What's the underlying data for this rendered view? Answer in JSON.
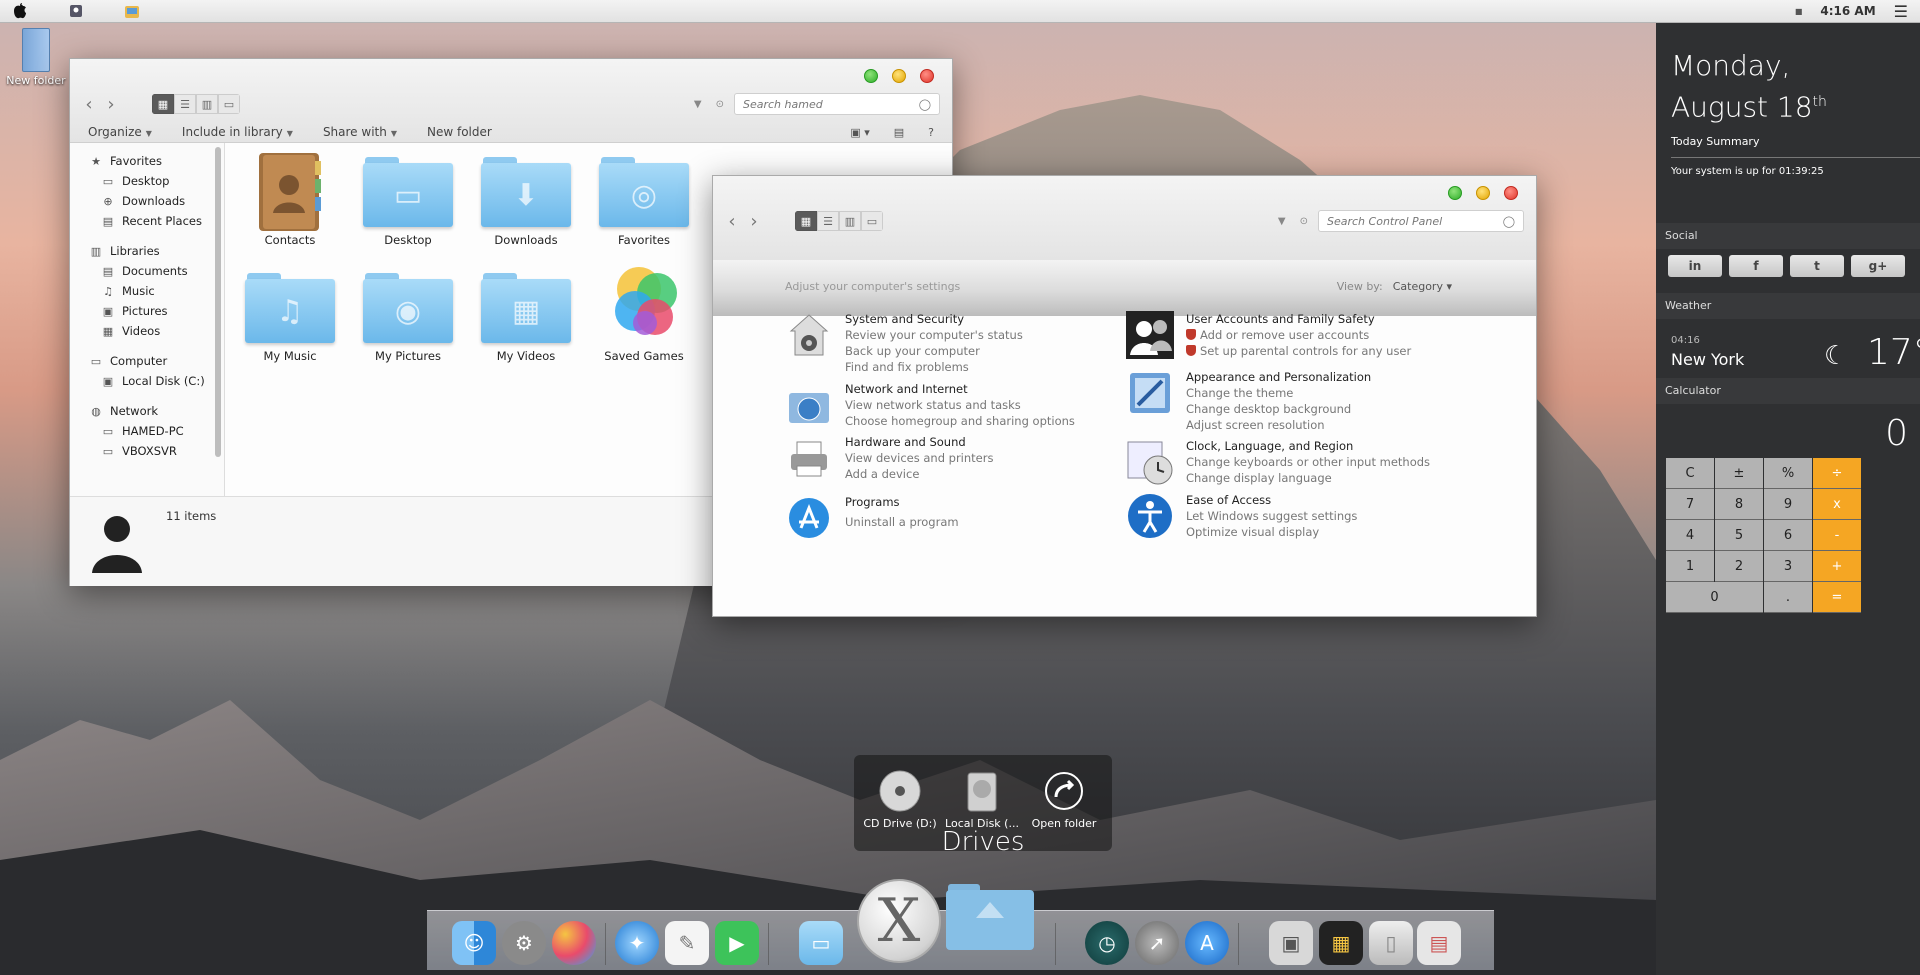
{
  "menubar": {
    "time": "4:16 AM"
  },
  "desktop": {
    "folder_label": "New folder"
  },
  "explorer": {
    "search_placeholder": "Search hamed",
    "commands": [
      "Organize",
      "Include in library",
      "Share with",
      "New folder"
    ],
    "nav": {
      "favorites": {
        "label": "Favorites",
        "items": [
          "Desktop",
          "Downloads",
          "Recent Places"
        ]
      },
      "libraries": {
        "label": "Libraries",
        "items": [
          "Documents",
          "Music",
          "Pictures",
          "Videos"
        ]
      },
      "computer": {
        "label": "Computer",
        "items": [
          "Local Disk (C:)"
        ]
      },
      "network": {
        "label": "Network",
        "items": [
          "HAMED-PC",
          "VBOXSVR"
        ]
      }
    },
    "files": [
      "Contacts",
      "Desktop",
      "Downloads",
      "Favorites",
      "My Music",
      "My Pictures",
      "My Videos",
      "Saved Games"
    ],
    "item_count": "11 items"
  },
  "control_panel": {
    "search_placeholder": "Search Control Panel",
    "heading": "Adjust your computer's settings",
    "view_by_label": "View by:",
    "view_by_value": "Category",
    "categories": [
      {
        "title": "System and Security",
        "links": [
          "Review your computer's status",
          "Back up your computer",
          "Find and fix problems"
        ]
      },
      {
        "title": "Network and Internet",
        "links": [
          "View network status and tasks",
          "Choose homegroup and sharing options"
        ]
      },
      {
        "title": "Hardware and Sound",
        "links": [
          "View devices and printers",
          "Add a device"
        ]
      },
      {
        "title": "Programs",
        "links": [
          "Uninstall a program"
        ]
      },
      {
        "title": "User Accounts and Family Safety",
        "links": [
          "Add or remove user accounts",
          "Set up parental controls for any user"
        ]
      },
      {
        "title": "Appearance and Personalization",
        "links": [
          "Change the theme",
          "Change desktop background",
          "Adjust screen resolution"
        ]
      },
      {
        "title": "Clock, Language, and Region",
        "links": [
          "Change keyboards or other input methods",
          "Change display language"
        ]
      },
      {
        "title": "Ease of Access",
        "links": [
          "Let Windows suggest settings",
          "Optimize visual display"
        ]
      }
    ]
  },
  "sidebar": {
    "day": "Monday,",
    "date": "August 18",
    "date_suffix": "th",
    "summary_title": "Today Summary",
    "uptime": "Your system is up for 01:39:25",
    "social_label": "Social",
    "social": [
      "in",
      "f",
      "t",
      "g+"
    ],
    "weather_label": "Weather",
    "weather_time": "04:16",
    "weather_city": "New York",
    "weather_temp": "17°",
    "calculator_label": "Calculator",
    "calc_display": "0",
    "calc_keys": [
      "C",
      "±",
      "%",
      "÷",
      "7",
      "8",
      "9",
      "x",
      "4",
      "5",
      "6",
      "-",
      "1",
      "2",
      "3",
      "+",
      "0",
      ".",
      "="
    ]
  },
  "drives": {
    "label": "Drives",
    "items": [
      "CD Drive (D:)",
      "Local Disk (...",
      "Open folder"
    ]
  },
  "colors": {
    "accent_orange": "#f5a623",
    "sidebar_bg": "#2f3032",
    "folder_blue": "#6bb8ea"
  }
}
